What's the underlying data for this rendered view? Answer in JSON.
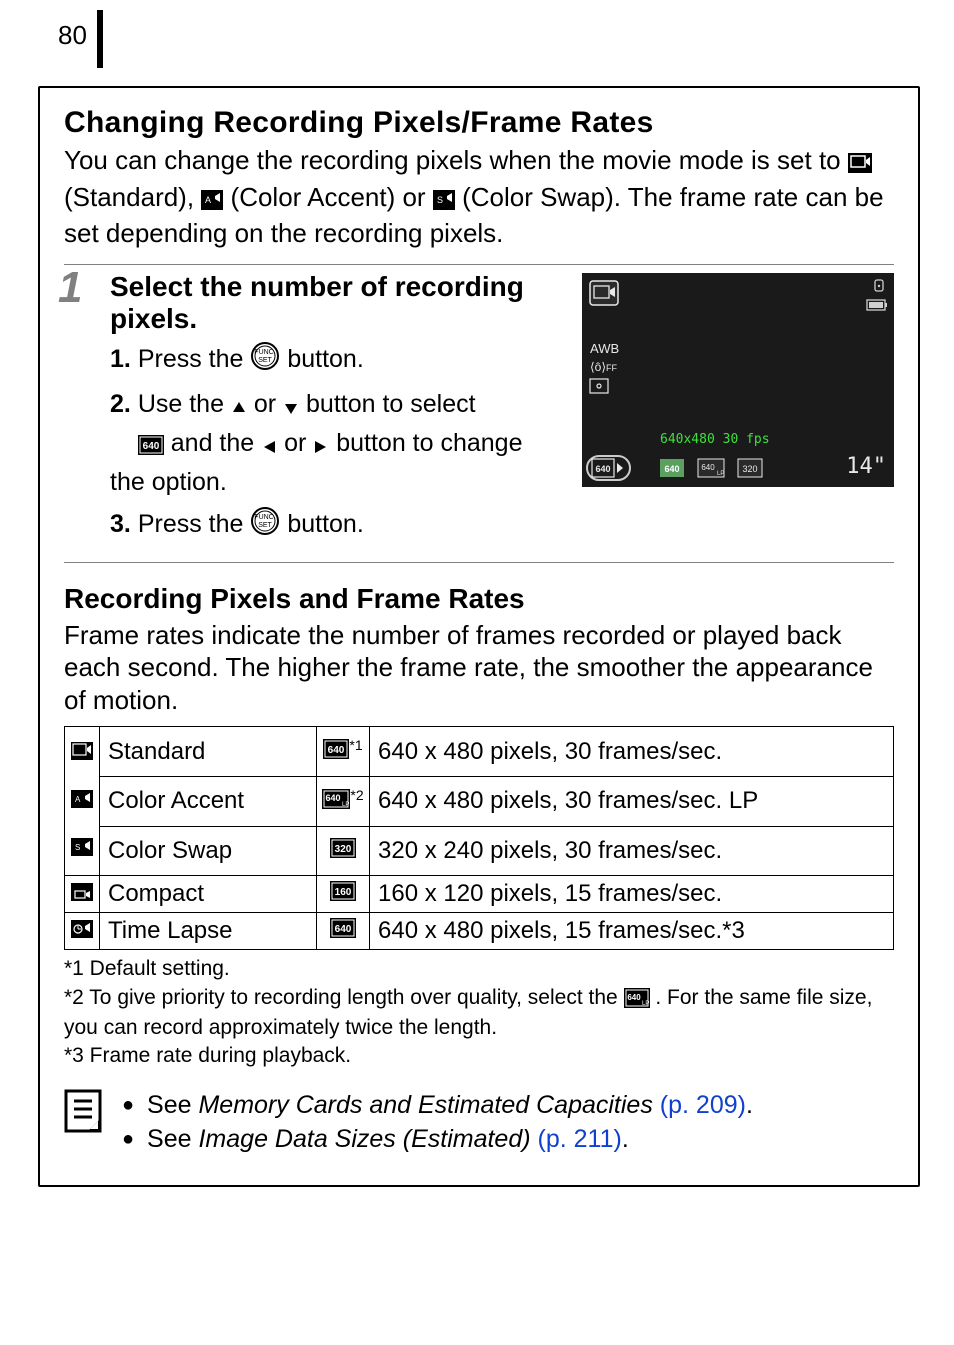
{
  "page_number": "80",
  "section1": {
    "title": "Changing Recording Pixels/Frame Rates",
    "intro_pre": "You can change the recording pixels when the movie mode is set to ",
    "intro_standard": " (Standard), ",
    "intro_accent": " (Color Accent) or ",
    "intro_swap": " (Color Swap). The frame rate can be set depending on the recording pixels."
  },
  "step": {
    "number": "1",
    "title": "Select the number of recording pixels.",
    "items": {
      "i1": {
        "num": "1.",
        "pre": "Press the ",
        "post": " button."
      },
      "i2": {
        "num": "2.",
        "a": "Use the ",
        "b": " or ",
        "c": " button to select ",
        "d": " and the ",
        "e": " or ",
        "f": " button to change the option."
      },
      "i3": {
        "num": "3.",
        "pre": "Press the ",
        "post": " button."
      }
    },
    "lcd": {
      "res_label": "640x480 30 fps",
      "time": "14\"",
      "sel": "640",
      "optA": "640",
      "optB": "640 LP",
      "optC": "320"
    }
  },
  "section2": {
    "title": "Recording Pixels and Frame Rates",
    "intro": "Frame rates indicate the number of frames recorded or played back each second. The higher the frame rate, the smoother the appearance of motion."
  },
  "table": {
    "rows": [
      {
        "mode": "Standard",
        "picon": "640",
        "star": "*1",
        "desc": "640 x 480 pixels, 30 frames/sec."
      },
      {
        "mode": "Color Accent",
        "picon": "640 LP",
        "star": "*2",
        "desc": "640 x 480 pixels, 30 frames/sec. LP"
      },
      {
        "mode": "Color Swap",
        "picon": "320",
        "star": "",
        "desc": "320 x 240 pixels, 30 frames/sec."
      },
      {
        "mode": "Compact",
        "picon": "160",
        "star": "",
        "desc": "160 x 120 pixels, 15 frames/sec."
      },
      {
        "mode": "Time Lapse",
        "picon": "640",
        "star": "",
        "desc": "640 x 480 pixels, 15 frames/sec.*3"
      }
    ]
  },
  "footnotes": {
    "f1": "*1 Default setting.",
    "f2a": "*2 To give priority to recording length over quality, select the ",
    "f2b": ". For the same file size, you can record approximately twice the length.",
    "f3": "*3 Frame rate during playback."
  },
  "see": {
    "s1_pre": "See ",
    "s1_it": "Memory Cards and Estimated Capacities",
    "s1_link": " (p. 209)",
    "s1_post": ".",
    "s2_pre": "See ",
    "s2_it": "Image Data Sizes (Estimated)",
    "s2_link": " (p. 211)",
    "s2_post": "."
  }
}
